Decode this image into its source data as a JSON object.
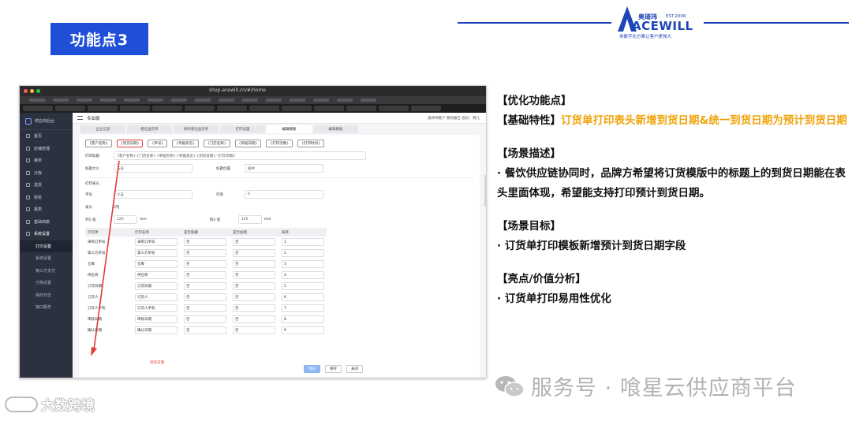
{
  "slide": {
    "badge": "功能点3",
    "logo": {
      "cn": "奥琦玮",
      "est": "EST.2006",
      "word": "ACEWILL",
      "tagline": "用数字化方案让客户更强大"
    }
  },
  "browser": {
    "url": "shop.acewill.cn/#/home",
    "app_name": "供应商后台",
    "sidebar": [
      {
        "label": "首页"
      },
      {
        "label": "店铺管理"
      },
      {
        "label": "接单"
      },
      {
        "label": "分拣"
      },
      {
        "label": "送货"
      },
      {
        "label": "财务"
      },
      {
        "label": "报表"
      },
      {
        "label": "基础档案"
      },
      {
        "label": "系统设置"
      }
    ],
    "sidebar_sub": [
      "打印设置",
      "系统设置",
      "第三方支付",
      "分拣设置",
      "操作日志",
      "接口服务"
    ],
    "topbar_title": "专业版",
    "topbar_right": "奥琦玮客户 我的报告 您好，晓儿",
    "subtabs": [
      "企业信息",
      "看任送货单",
      "修改看任送货单",
      "打印设置",
      "编辑模板",
      "编辑模板"
    ],
    "chips": [
      "{客户名称}",
      "{到货日期}",
      "{单号}",
      "{单据状态}",
      "{门店名称}",
      "{单据日期}",
      "{打印次数}",
      "{打印时间}"
    ],
    "print_title_label": "打印标题",
    "print_title_value": "{客户名称}-{门店名称}-{单据名称}-{单据状态}-{到货日期}-{打印次数}",
    "title_size_label": "标题大小",
    "title_size_value": "五号",
    "title_pos_label": "标题位置",
    "title_pos_value": "居中",
    "section_header": "打印表头",
    "font_label": "字号",
    "font_value": "小五",
    "rowh_label": "行高",
    "rowh_value": "6",
    "header_label": "表头",
    "header_opt2": "2列",
    "colw_label": "列1-宽",
    "colw_value": "120",
    "colw2_label": "列2-宽",
    "colw2_value": "120",
    "unit": "mm",
    "table_headers": [
      "打印项",
      "打印名称",
      "是否隐藏",
      "是否加粗",
      "排序"
    ],
    "table_rows": [
      [
        "采购订单号",
        "采购订单号",
        "否",
        "否",
        "1"
      ],
      [
        "第三方单号",
        "第三方单号",
        "否",
        "否",
        "2"
      ],
      [
        "仓库",
        "仓库",
        "否",
        "否",
        "3"
      ],
      [
        "供应商",
        "供应商",
        "否",
        "否",
        "4"
      ],
      [
        "订货日期",
        "订货日期",
        "否",
        "否",
        "5"
      ],
      [
        "订货人",
        "订货人",
        "否",
        "否",
        "6"
      ],
      [
        "订货人手机",
        "订货人手机",
        "否",
        "否",
        "7"
      ],
      [
        "审核日期",
        "审核日期",
        "否",
        "否",
        "8"
      ],
      [
        "确认日期",
        "确认日期",
        "否",
        "否",
        "9"
      ]
    ],
    "extra_field": "到货日期",
    "buttons": [
      "预览",
      "保存",
      "关闭"
    ]
  },
  "panel": {
    "opt_title": "【优化功能点】",
    "base_label": "【基础特性】",
    "base_text": "订货单打印表头新增到货日期&统一到货日期为预计到货日期",
    "scene_title": "【场景描述】",
    "scene_text": "· 餐饮供应链协同时，品牌方希望将订货模版中的标题上的到货日期能在表头里面体现，希望能支持打印预计到货日期。",
    "goal_title": "【场景目标】",
    "goal_text": "· 订货单打印模板新增预计到货日期字段",
    "value_title": "【亮点/价值分析】",
    "value_text": "· 订货单打印易用性优化"
  },
  "watermarks": {
    "left": "大数跨境",
    "right": "服务号 · 喰星云供应商平台"
  },
  "colors": {
    "badge": "#1f4fd6",
    "accent": "#f0a30a",
    "highlight": "#e53935"
  }
}
